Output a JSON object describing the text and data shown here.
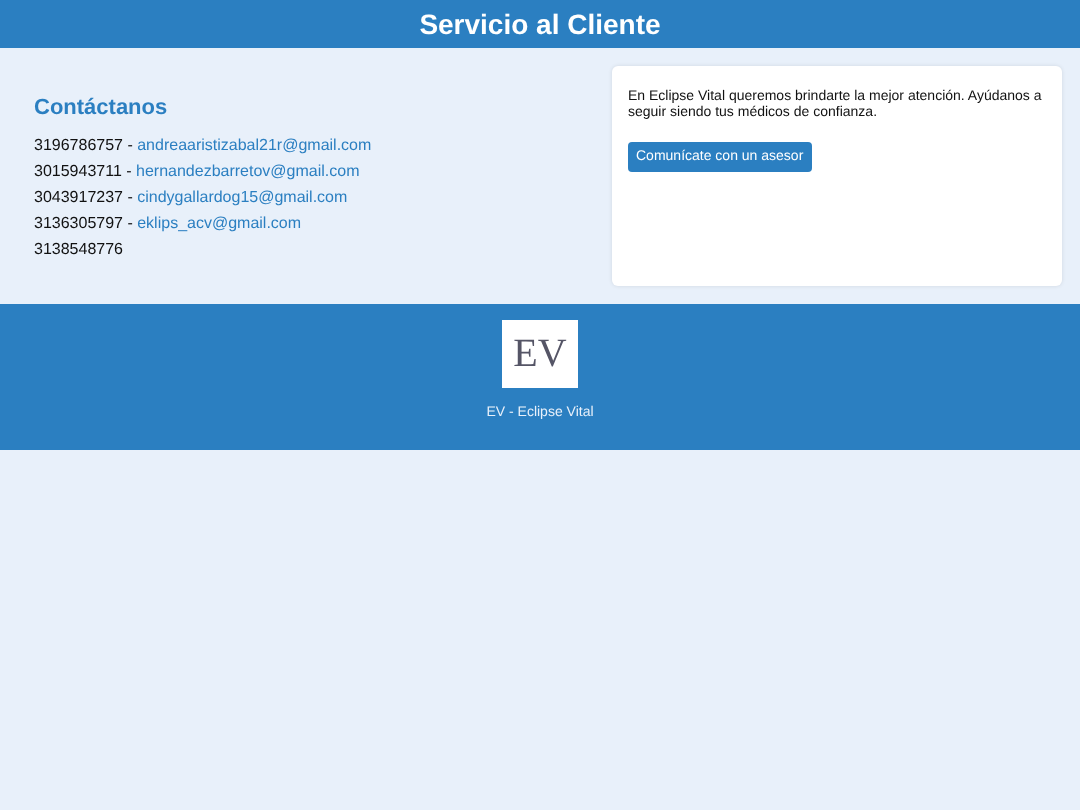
{
  "header": {
    "title": "Servicio al Cliente"
  },
  "contact": {
    "heading": "Contáctanos",
    "entries": [
      {
        "phone": "3196786757",
        "separator": " - ",
        "email": "andreaaristizabal21r@gmail.com"
      },
      {
        "phone": "3015943711",
        "separator": " - ",
        "email": "hernandezbarretov@gmail.com"
      },
      {
        "phone": "3043917237",
        "separator": " - ",
        "email": "cindygallardog15@gmail.com"
      },
      {
        "phone": "3136305797",
        "separator": " - ",
        "email": "eklips_acv@gmail.com"
      },
      {
        "phone": "3138548776"
      }
    ]
  },
  "card": {
    "text": "En Eclipse Vital queremos brindarte la mejor atención. Ayúdanos a seguir siendo tus médicos de confianza.",
    "button": "Comunícate con un asesor"
  },
  "footer": {
    "logo_text": "EV",
    "caption": "EV - Eclipse Vital"
  }
}
